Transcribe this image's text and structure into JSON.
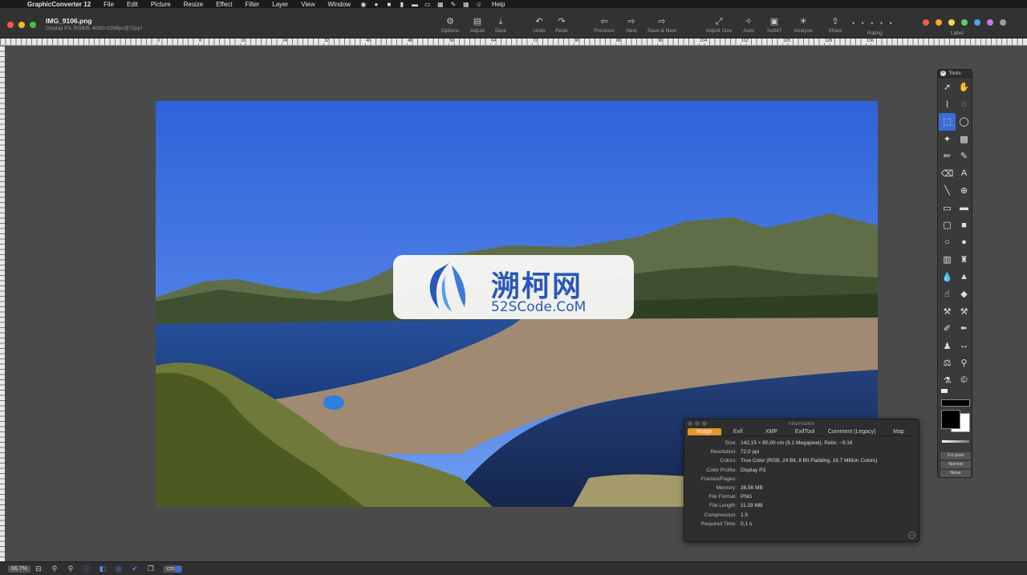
{
  "menubar": {
    "app": "GraphicConverter 12",
    "items": [
      "File",
      "Edit",
      "Picture",
      "Resize",
      "Effect",
      "Filter",
      "Layer",
      "View",
      "Window"
    ],
    "help": "Help"
  },
  "document": {
    "title": "IMG_9106.png",
    "subtitle": "Display P3, RGB/8, 4030×2268px@72ppi"
  },
  "toolbar": {
    "options": "Options",
    "adjust": "Adjust",
    "save": "Save",
    "undo": "Undo",
    "redo": "Redo",
    "previous": "Previous",
    "next": "Next",
    "save_next": "Save & Next",
    "adjust_size": "Adjust Size",
    "auto": "Auto",
    "xe847": "Xe847",
    "analyze": "Analyze",
    "share": "Share",
    "rating": "Rating",
    "rating_dots": "• • • • •",
    "label": "Label"
  },
  "label_colors": [
    "#f25a4f",
    "#f5a623",
    "#f7d84a",
    "#5fcf5f",
    "#4aa3f0",
    "#c479e8",
    "#9b9b9b"
  ],
  "ruler": {
    "ticks": [
      "0",
      "8",
      "16",
      "24",
      "32",
      "40",
      "48",
      "56",
      "64",
      "72",
      "80",
      "88",
      "96",
      "104",
      "112",
      "120",
      "128",
      "136"
    ]
  },
  "watermark": {
    "main": "溯柯网",
    "sub": "52SCode.CoM"
  },
  "tools": {
    "title": "Tools",
    "stroke_value": "3.0 pixel",
    "mode": "Normal",
    "extra": "None"
  },
  "info": {
    "title": "Information",
    "tabs": [
      "Image",
      "Exif",
      "XMP",
      "ExifTool",
      "Comment (Legacy)",
      "Map"
    ],
    "rows": [
      {
        "k": "Size:",
        "v": "142,15 × 80,00 cm (9,1 Megapixel), Ratio: ~9:16"
      },
      {
        "k": "Resolution:",
        "v": "72,0 ppi"
      },
      {
        "k": "Colors:",
        "v": "True Color (RGB, 24 Bit, 8 Bit Padding, 16.7 Million Colors)"
      },
      {
        "k": "Color Profile:",
        "v": "Display P3"
      },
      {
        "k": "Frames/Pages:",
        "v": ""
      },
      {
        "k": "Memory:",
        "v": "36.56 MB"
      },
      {
        "k": "File Format:",
        "v": "PNG"
      },
      {
        "k": "File Length:",
        "v": "11.29 MB"
      },
      {
        "k": "Compression:",
        "v": "1:3"
      },
      {
        "k": "Required Time:",
        "v": "0,1 s"
      }
    ]
  },
  "statusbar": {
    "zoom": "66.7%",
    "unit": "cm"
  }
}
